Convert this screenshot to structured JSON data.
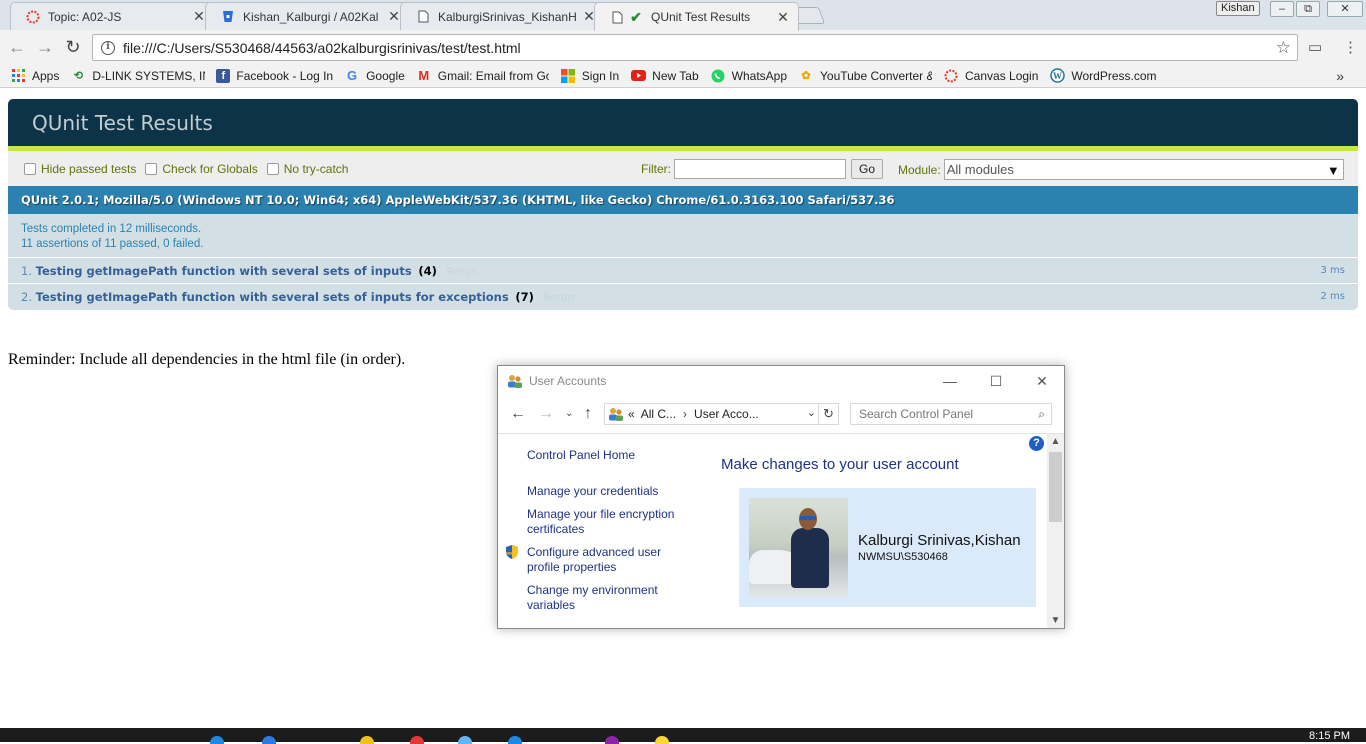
{
  "browser": {
    "tabs": [
      {
        "title": "Topic: A02-JS",
        "icon": "canvas-icon",
        "active": false
      },
      {
        "title": "Kishan_Kalburgi / A02Kal",
        "icon": "bitbucket-icon",
        "active": false
      },
      {
        "title": "KalburgiSrinivas_KishanH",
        "icon": "page-icon",
        "active": false
      },
      {
        "title": "QUnit Test Results",
        "icon": "checkmark-icon",
        "active": true
      }
    ],
    "profile_name": "Kishan",
    "url": "file:///C:/Users/S530468/44563/a02kalburgisrinivas/test/test.html",
    "bookmarks": [
      {
        "label": "Apps",
        "icon": "apps-grid-icon"
      },
      {
        "label": "D-LINK SYSTEMS, INC",
        "icon": "dlink-icon"
      },
      {
        "label": "Facebook - Log In",
        "icon": "facebook-icon"
      },
      {
        "label": "Google",
        "icon": "google-icon"
      },
      {
        "label": "Gmail: Email from Go",
        "icon": "gmail-icon"
      },
      {
        "label": "Sign In",
        "icon": "microsoft-icon"
      },
      {
        "label": "New Tab",
        "icon": "youtube-icon"
      },
      {
        "label": "WhatsApp",
        "icon": "whatsapp-icon"
      },
      {
        "label": "YouTube Converter &",
        "icon": "converter-icon"
      },
      {
        "label": "Canvas Login",
        "icon": "canvas-icon"
      },
      {
        "label": "WordPress.com",
        "icon": "wordpress-icon"
      }
    ]
  },
  "qunit": {
    "title": "QUnit Test Results",
    "options": {
      "hide_passed": "Hide passed tests",
      "check_globals": "Check for Globals",
      "no_try_catch": "No try-catch"
    },
    "filter_label": "Filter:",
    "go_label": "Go",
    "module_label": "Module:",
    "module_value": "All modules",
    "user_agent": "QUnit 2.0.1; Mozilla/5.0 (Windows NT 10.0; Win64; x64) AppleWebKit/537.36 (KHTML, like Gecko) Chrome/61.0.3163.100 Safari/537.36",
    "summary_line1": "Tests completed in 12 milliseconds.",
    "summary_line2": "11 assertions of 11 passed, 0 failed.",
    "tests": [
      {
        "num": "1.",
        "name": "Testing getImagePath function with several sets of inputs",
        "count": "(4)",
        "rerun": "Rerun",
        "duration": "3 ms"
      },
      {
        "num": "2.",
        "name": "Testing getImagePath function with several sets of inputs for exceptions",
        "count": "(7)",
        "rerun": "Rerun",
        "duration": "2 ms"
      }
    ]
  },
  "reminder": "Reminder: Include all dependencies in the html file (in order).",
  "user_accounts": {
    "window_title": "User Accounts",
    "breadcrumb_prefix": "«",
    "breadcrumb_1": "All C...",
    "breadcrumb_2": "User Acco...",
    "search_placeholder": "Search Control Panel",
    "left_links": {
      "home": "Control Panel Home",
      "credentials": "Manage your credentials",
      "encryption": "Manage your file encryption certificates",
      "profile": "Configure advanced user profile properties",
      "environment": "Change my environment variables"
    },
    "heading": "Make changes to your user account",
    "user_name": "Kalburgi Srinivas,Kishan",
    "user_account": "NWMSU\\S530468"
  },
  "taskbar": {
    "clock": "8:15 PM"
  },
  "colors": {
    "qunit_header": "#0d3349",
    "qunit_banner_pass": "#c6e746",
    "qunit_useragent": "#2b81af",
    "qunit_result": "#d2e0e6",
    "cp_link": "#1e3287",
    "cp_card": "#dbeafa"
  }
}
